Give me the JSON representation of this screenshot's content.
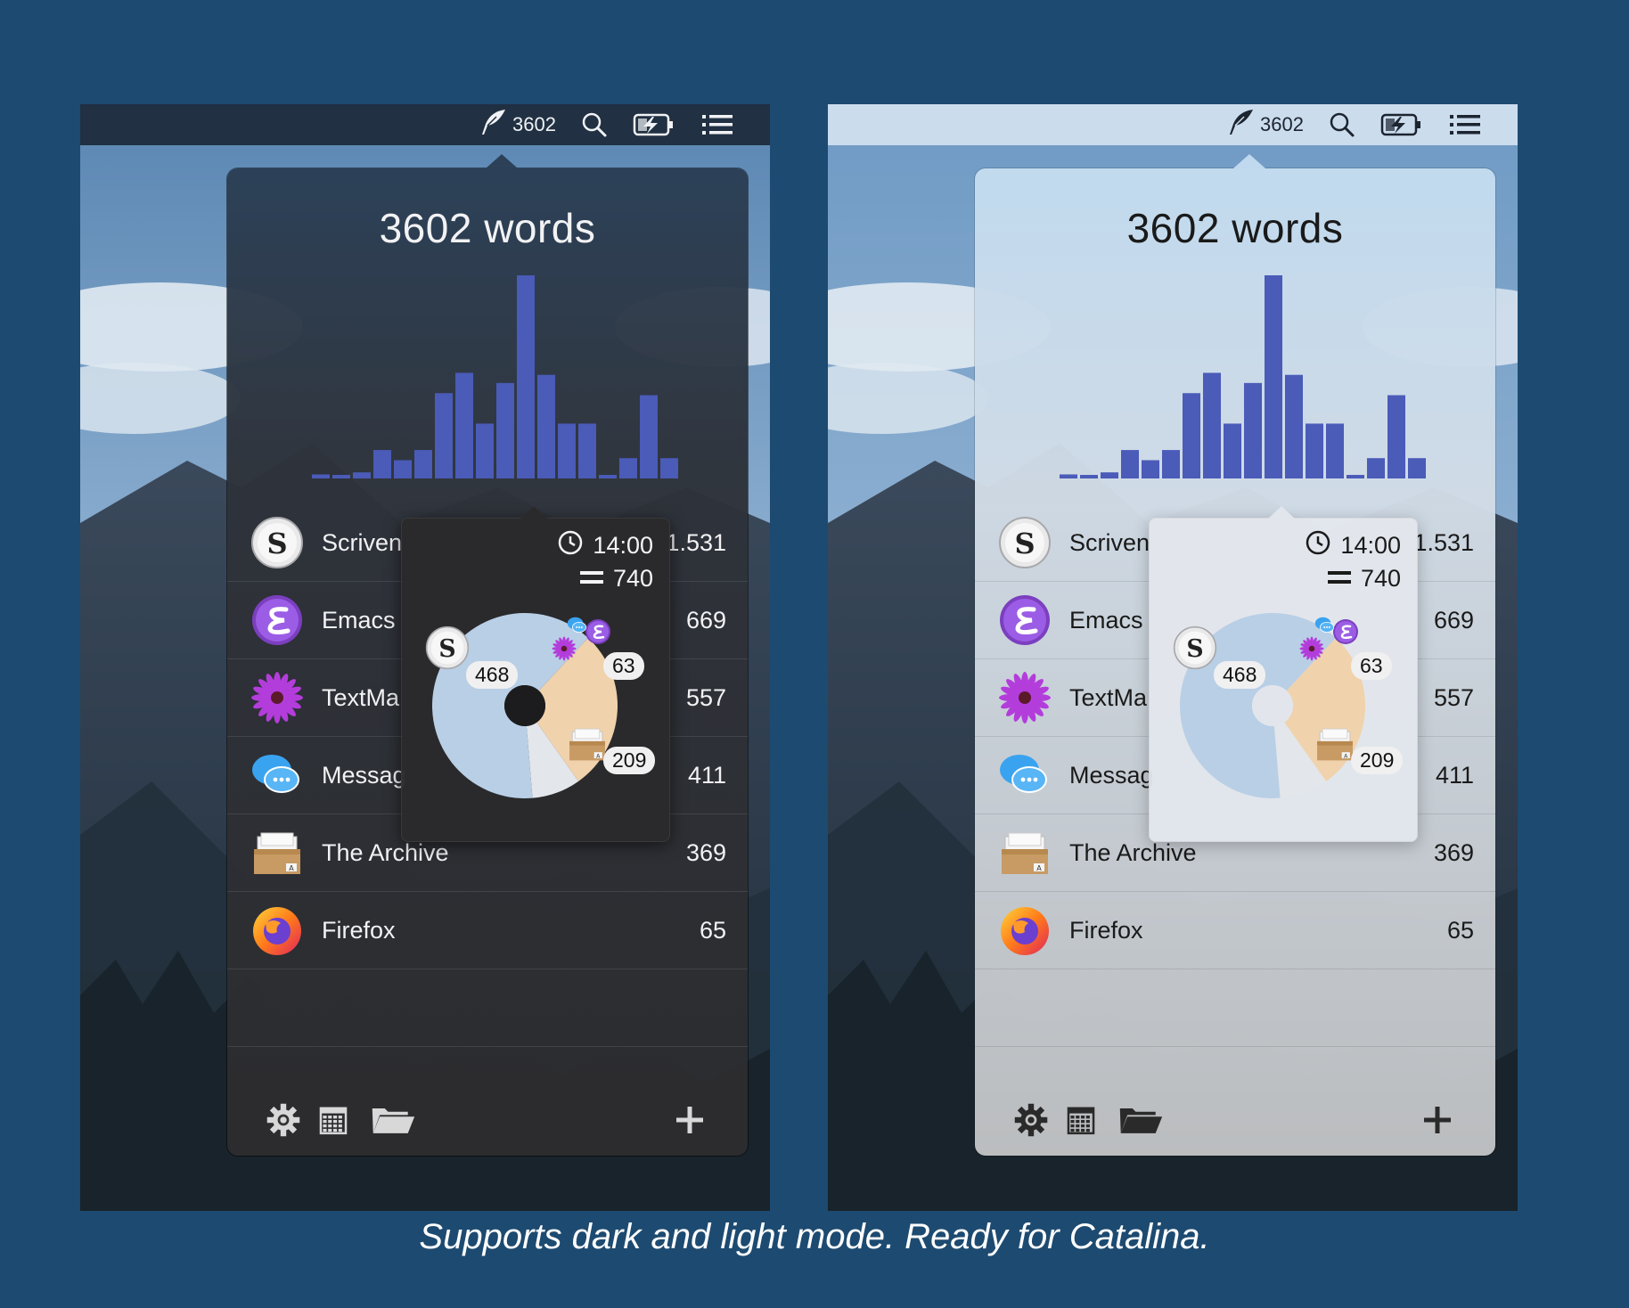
{
  "menubar": {
    "word_count": "3602",
    "icons": [
      "quill-icon",
      "search-icon",
      "battery-charging-icon",
      "list-icon"
    ]
  },
  "popover": {
    "total_label": "3602 words",
    "histogram": {
      "color": "#4a5bb8",
      "values": [
        2,
        0,
        3,
        14,
        9,
        14,
        42,
        52,
        27,
        47,
        100,
        51,
        27,
        27,
        1,
        10,
        41,
        10
      ]
    },
    "apps": [
      {
        "name": "Scrivener",
        "visible_name": "Scriven",
        "count": "1.531",
        "visible_count": "1.531",
        "icon": "scrivener-icon"
      },
      {
        "name": "Emacs",
        "visible_name": "Emacs",
        "count": "669",
        "visible_count": "669",
        "icon": "emacs-icon"
      },
      {
        "name": "TextMate",
        "visible_name": "TextMa",
        "count": "557",
        "visible_count": "557",
        "icon": "textmate-icon"
      },
      {
        "name": "Messages",
        "visible_name": "Messag",
        "count": "411",
        "visible_count": "411",
        "icon": "messages-icon"
      },
      {
        "name": "The Archive",
        "visible_name": "The Archive",
        "count": "369",
        "visible_count": "369",
        "icon": "archive-icon"
      },
      {
        "name": "Firefox",
        "visible_name": "Firefox",
        "count": "65",
        "visible_count": "65",
        "icon": "firefox-icon"
      }
    ],
    "tooltip": {
      "time": "14:00",
      "count": "740",
      "slices": [
        {
          "app": "Scrivener",
          "value": 468,
          "color": "#b9cfe6"
        },
        {
          "app": "The Archive",
          "value": 209,
          "color": "#f0d2ac"
        },
        {
          "app": "Emacs/TextMate/Messages",
          "value": 63,
          "color": "#e3e6ea"
        }
      ],
      "labels": [
        "468",
        "63",
        "209"
      ]
    },
    "footer": {
      "buttons": [
        "gear-icon",
        "calendar-icon",
        "folder-icon",
        "plus-icon"
      ]
    }
  },
  "caption": "Supports dark and light mode. Ready for Catalina."
}
